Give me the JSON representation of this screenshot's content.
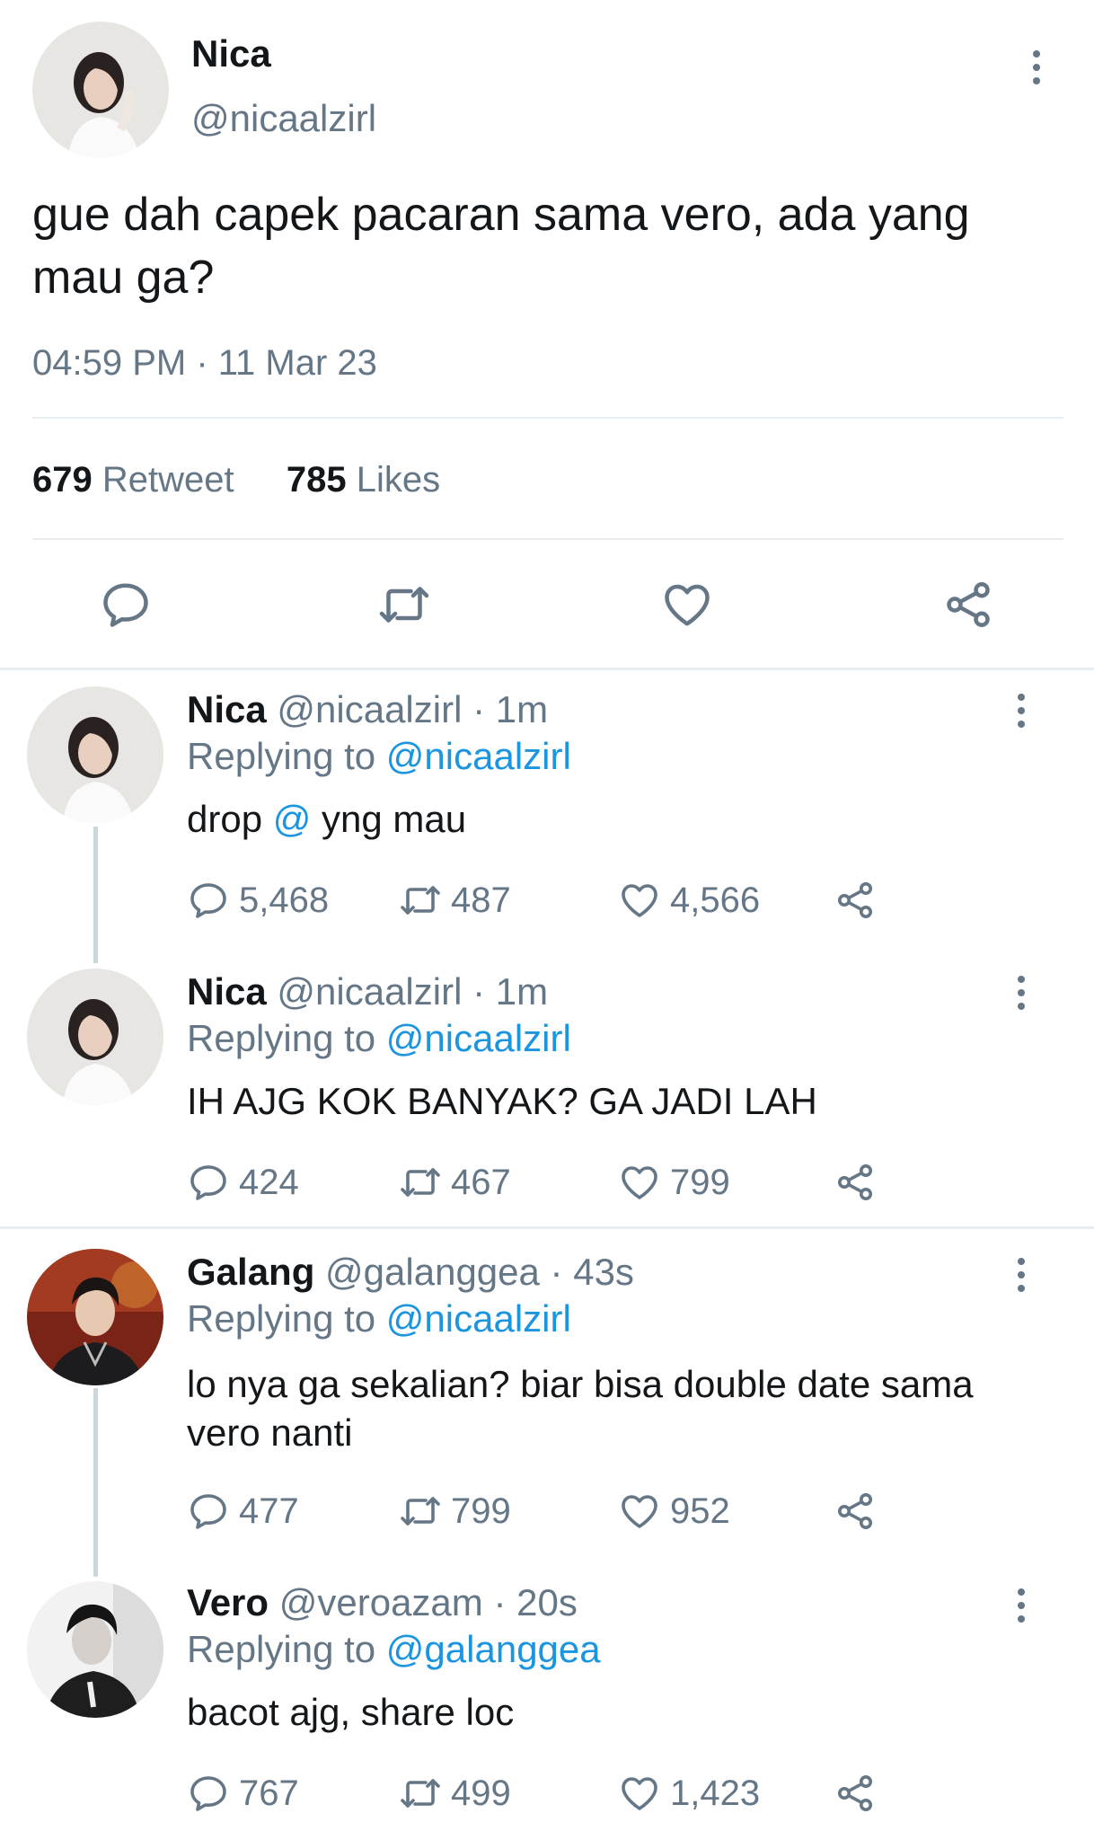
{
  "main": {
    "name": "Nica",
    "handle": "@nicaalzirl",
    "text": "gue dah capek pacaran sama vero, ada yang mau ga?",
    "time": "04:59 PM · 11 Mar 23",
    "retweet_count": "679",
    "retweet_label": "Retweet",
    "like_count": "785",
    "like_label": "Likes"
  },
  "replies": [
    {
      "name": "Nica",
      "meta": "@nicaalzirl · 1m",
      "replying_prefix": "Replying to",
      "replying_to": "@nicaalzirl",
      "text_before": "drop",
      "text_mention": "@",
      "text_after": "yng mau",
      "comments": "5,468",
      "retweets": "487",
      "likes": "4,566"
    },
    {
      "name": "Nica",
      "meta": "@nicaalzirl · 1m",
      "replying_prefix": "Replying to",
      "replying_to": "@nicaalzirl",
      "text": "IH AJG KOK BANYAK? GA JADI LAH",
      "comments": "424",
      "retweets": "467",
      "likes": "799"
    },
    {
      "name": "Galang",
      "meta": "@galanggea · 43s",
      "replying_prefix": "Replying to",
      "replying_to": "@nicaalzirl",
      "text": "lo nya ga sekalian? biar bisa double date sama vero nanti",
      "comments": "477",
      "retweets": "799",
      "likes": "952"
    },
    {
      "name": "Vero",
      "meta": "@veroazam · 20s",
      "replying_prefix": "Replying to",
      "replying_to": "@galanggea",
      "text": "bacot ajg, share loc",
      "comments": "767",
      "retweets": "499",
      "likes": "1,423"
    }
  ],
  "colors": {
    "text": "#14171a",
    "secondary": "#657786",
    "link": "#1b95e0",
    "divider": "#e6ecf0"
  },
  "icons": [
    "more-icon",
    "reply-icon",
    "retweet-icon",
    "like-icon",
    "share-icon",
    "avatar"
  ]
}
